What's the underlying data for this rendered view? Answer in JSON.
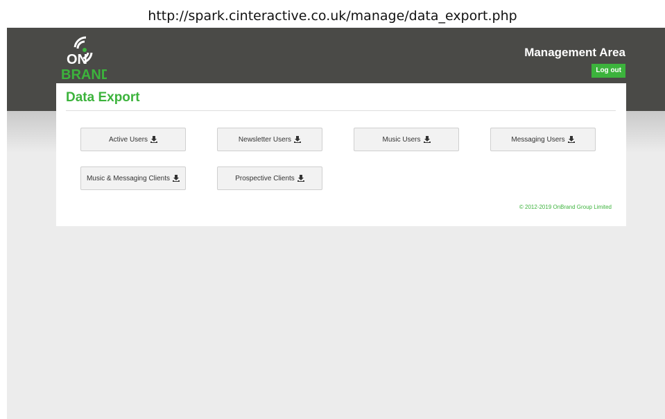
{
  "url": "http://spark.cinteractive.co.uk/manage/data_export.php",
  "header": {
    "logo_text_top": "ON",
    "logo_text_bottom": "BRAND",
    "area_title": "Management Area",
    "logout_label": "Log out"
  },
  "page": {
    "title": "Data Export",
    "buttons": [
      {
        "label": "Active Users",
        "icon": "download-icon"
      },
      {
        "label": "Newsletter Users",
        "icon": "download-icon"
      },
      {
        "label": "Music Users",
        "icon": "download-icon"
      },
      {
        "label": "Messaging Users",
        "icon": "download-icon"
      },
      {
        "label": "Music & Messaging Clients",
        "icon": "download-icon"
      },
      {
        "label": "Prospective Clients",
        "icon": "download-icon"
      }
    ],
    "copyright": "© 2012-2019 OnBrand Group Limited"
  },
  "colors": {
    "brand_green": "#3cb33c",
    "header_bg": "#4a4a47",
    "page_bg": "#ececec"
  }
}
